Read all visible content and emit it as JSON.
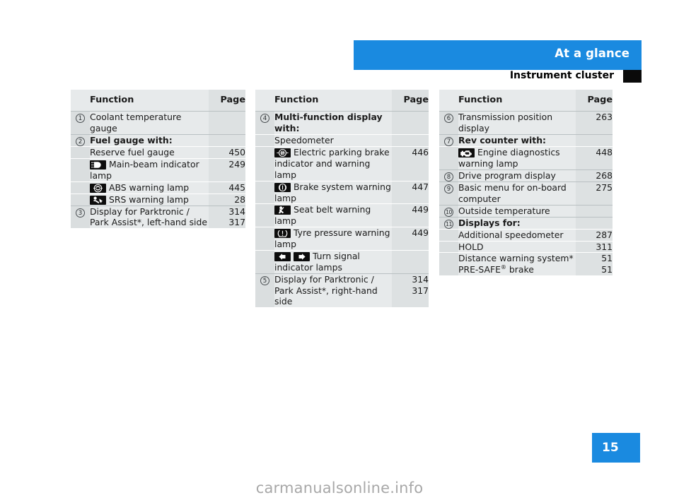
{
  "header": {
    "section_title": "At a glance",
    "page_title": "Instrument cluster",
    "accent_color": "#1a8ae0",
    "marker_color": "#0a0a0a"
  },
  "footer": {
    "page_number": "15",
    "watermark": "carmanualsonline.info"
  },
  "columns": [
    {
      "head": {
        "function": "Function",
        "page": "Page"
      },
      "rows": [
        {
          "num": "1",
          "text": "Coolant temperature gauge",
          "page": ""
        },
        {
          "num": "2",
          "text": "Fuel gauge with:",
          "page": "",
          "bold": true
        },
        {
          "num": "",
          "text": "Reserve fuel gauge",
          "page": "450"
        },
        {
          "num": "",
          "icon": "main-beam-lamp-icon",
          "text": "Main-beam indicator lamp",
          "page": "249"
        },
        {
          "num": "",
          "icon": "abs-warning-lamp-icon",
          "text": "ABS warning lamp",
          "page": "445"
        },
        {
          "num": "",
          "icon": "srs-warning-lamp-icon",
          "text": "SRS warning lamp",
          "page": "28"
        },
        {
          "num": "3",
          "text": "Display for Parktronic /\nPark Assist*, left-hand side",
          "page": "314\n317"
        }
      ]
    },
    {
      "head": {
        "function": "Function",
        "page": "Page"
      },
      "rows": [
        {
          "num": "4",
          "text": "Multi-function display with:",
          "page": "",
          "bold": true
        },
        {
          "num": "",
          "text": "Speedometer",
          "page": ""
        },
        {
          "num": "",
          "icon": "electric-parking-brake-lamp-icon",
          "text": "Electric parking brake indicator and warning lamp",
          "page": "446"
        },
        {
          "num": "",
          "icon": "brake-system-lamp-icon",
          "text": "Brake system warning lamp",
          "page": "447"
        },
        {
          "num": "",
          "icon": "seat-belt-warning-lamp-icon",
          "text": "Seat belt warning lamp",
          "page": "449"
        },
        {
          "num": "",
          "icon": "tyre-pressure-warning-lamp-icon",
          "text": "Tyre pressure warning lamp",
          "page": "449"
        },
        {
          "num": "",
          "icon": "turn-signal-lamps-icon",
          "text": "Turn signal indicator lamps",
          "page": ""
        },
        {
          "num": "5",
          "text": "Display for Parktronic /\nPark Assist*, right-hand side",
          "page": "314\n317"
        }
      ]
    },
    {
      "head": {
        "function": "Function",
        "page": "Page"
      },
      "rows": [
        {
          "num": "6",
          "text": "Transmission position display",
          "page": "263"
        },
        {
          "num": "7",
          "text": "Rev counter with:",
          "page": "",
          "bold": true
        },
        {
          "num": "",
          "icon": "engine-diagnostics-lamp-icon",
          "text": "Engine diagnostics warning lamp",
          "page": "448"
        },
        {
          "num": "8",
          "text": "Drive program display",
          "page": "268"
        },
        {
          "num": "9",
          "text": "Basic menu for on-board computer",
          "page": "275"
        },
        {
          "num": "10",
          "text": "Outside temperature",
          "page": ""
        },
        {
          "num": "11",
          "text": "Displays for:",
          "page": "",
          "bold": true
        },
        {
          "num": "",
          "text": "Additional speedometer",
          "page": "287"
        },
        {
          "num": "",
          "text": "HOLD",
          "page": "311"
        },
        {
          "num": "",
          "text": "Distance warning system*\nPRE-SAFE® brake",
          "page": "51\n51",
          "html": true
        }
      ]
    }
  ]
}
